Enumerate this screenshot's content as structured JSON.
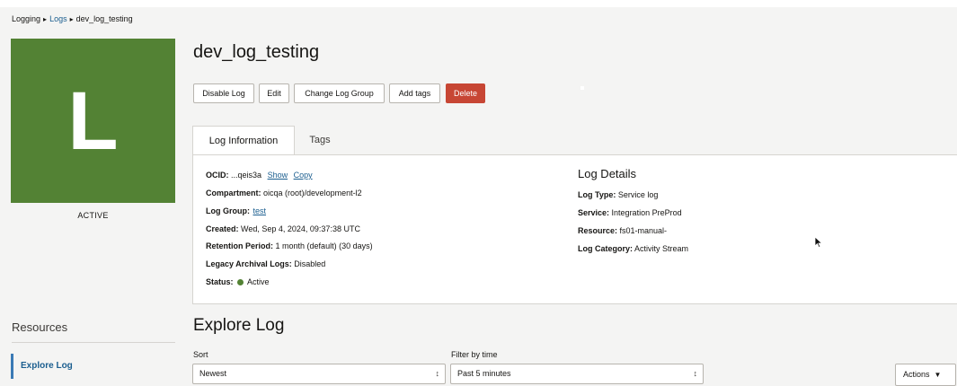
{
  "breadcrumb": {
    "items": [
      "Logging",
      "Logs",
      "dev_log_testing"
    ]
  },
  "avatar": {
    "letter": "L",
    "status": "ACTIVE",
    "color": "#538234"
  },
  "resources": {
    "title": "Resources",
    "items": [
      "Explore Log"
    ]
  },
  "page": {
    "title": "dev_log_testing"
  },
  "actions": {
    "disable": "Disable Log",
    "edit": "Edit",
    "change_group": "Change Log Group",
    "add_tags": "Add tags",
    "delete": "Delete"
  },
  "tabs": {
    "active": "Log Information",
    "other": "Tags"
  },
  "info": {
    "ocid_label": "OCID:",
    "ocid_value": "...qeis3a",
    "ocid_show": "Show",
    "ocid_copy": "Copy",
    "compartment_label": "Compartment:",
    "compartment_value": "oicqa (root)/development-l2",
    "log_group_label": "Log Group:",
    "log_group_value": "test",
    "created_label": "Created:",
    "created_value": "Wed, Sep 4, 2024, 09:37:38 UTC",
    "retention_label": "Retention Period:",
    "retention_value": "1 month (default) (30 days)",
    "legacy_label": "Legacy Archival Logs:",
    "legacy_value": "Disabled",
    "status_label": "Status:",
    "status_value": "Active"
  },
  "details": {
    "title": "Log Details",
    "log_type_label": "Log Type:",
    "log_type_value": "Service log",
    "service_label": "Service:",
    "service_value": "Integration PreProd",
    "resource_label": "Resource:",
    "resource_value": "fs01-manual-",
    "category_label": "Log Category:",
    "category_value": "Activity Stream"
  },
  "explore": {
    "title": "Explore Log",
    "sort_label": "Sort",
    "sort_value": "Newest",
    "filter_label": "Filter by time",
    "filter_value": "Past 5 minutes",
    "actions_label": "Actions"
  }
}
